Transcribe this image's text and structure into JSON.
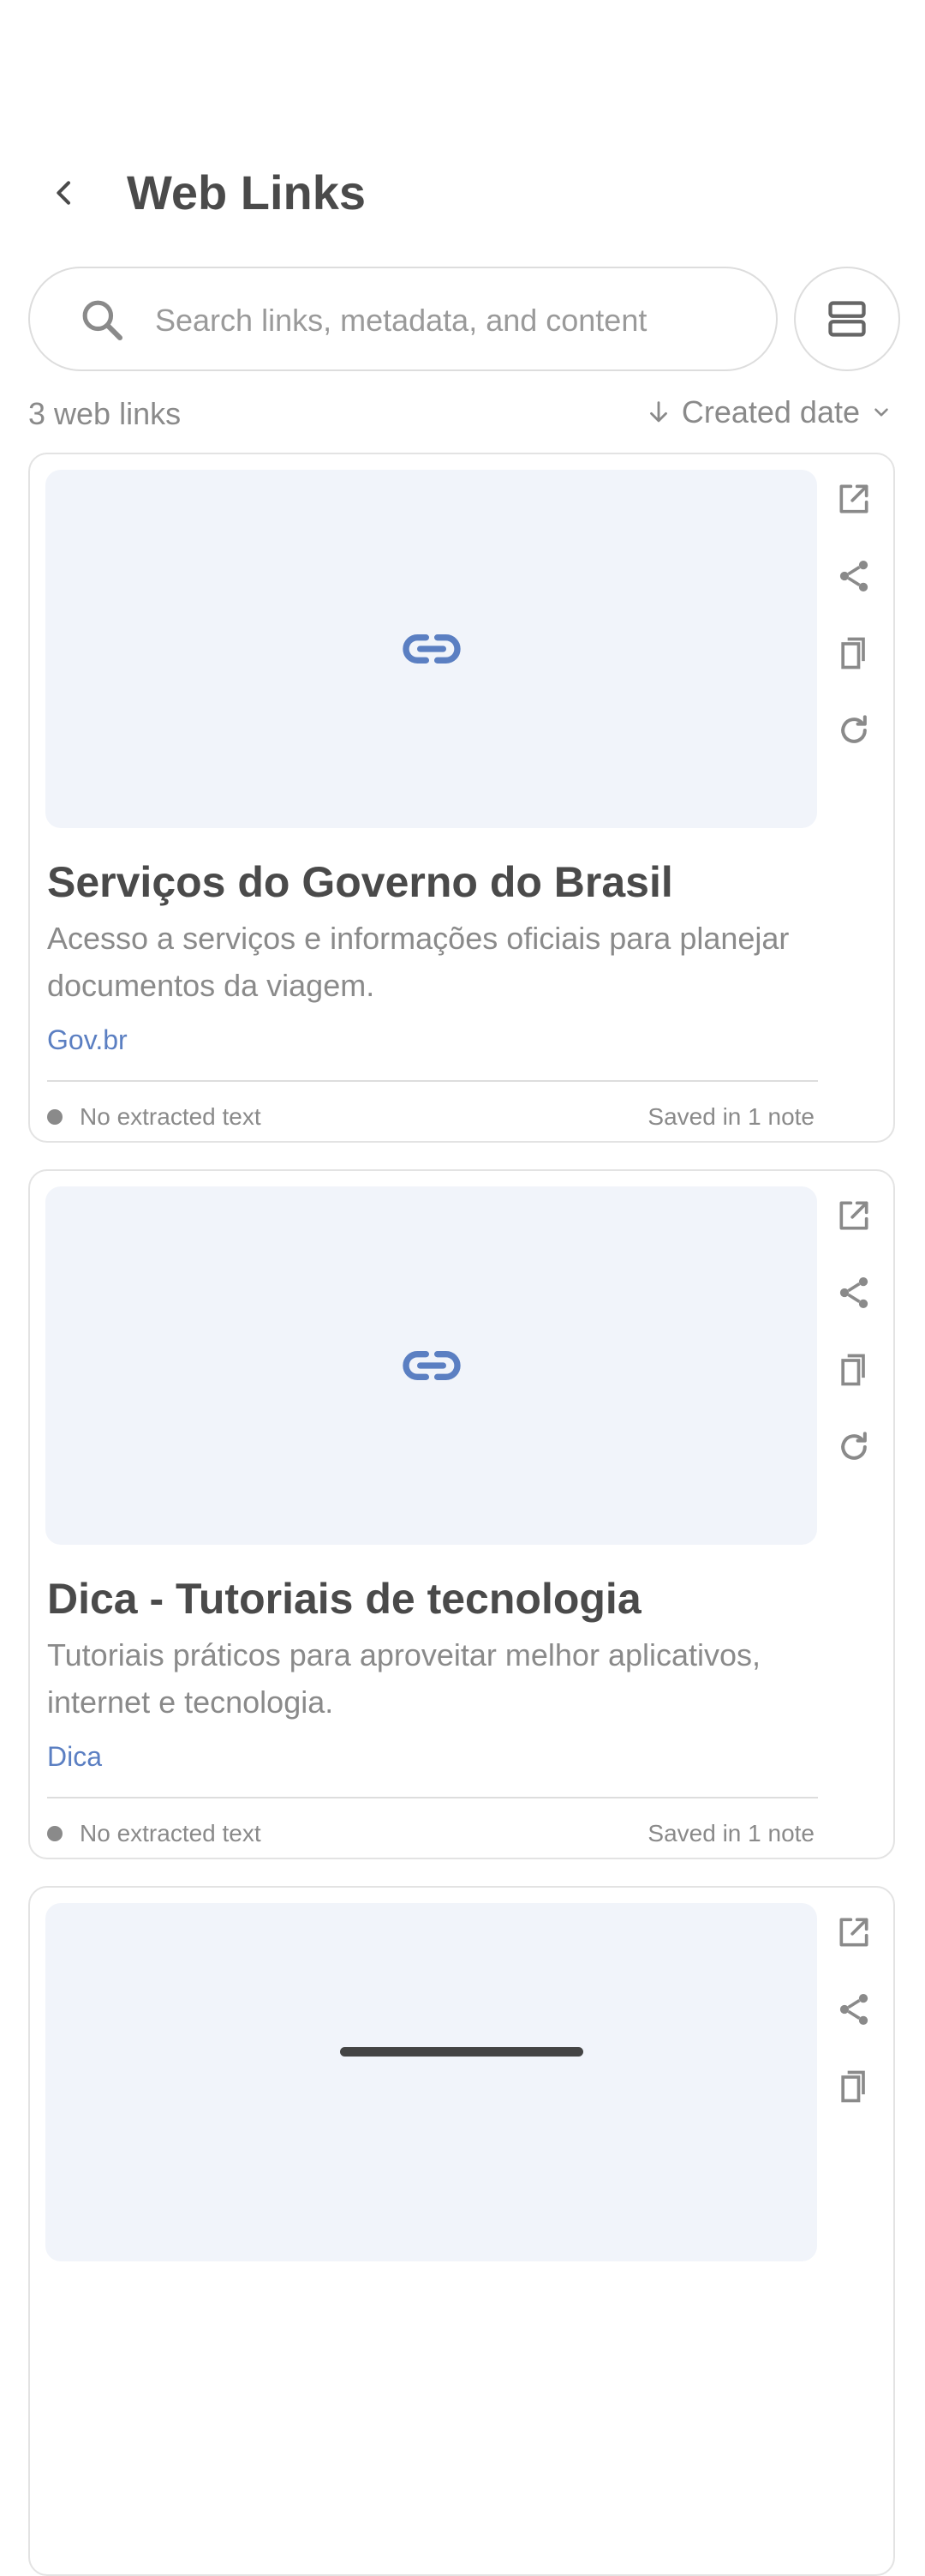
{
  "header": {
    "title": "Web Links"
  },
  "search": {
    "placeholder": "Search links, metadata, and content"
  },
  "list": {
    "count_label": "3 web links",
    "sort_label": "Created date"
  },
  "cards": [
    {
      "title": "Serviços do Governo do Brasil",
      "description": "Acesso a serviços e informações oficiais para planejar documentos da viagem.",
      "domain": "Gov.br",
      "status": "No extracted text",
      "saved": "Saved in 1 note"
    },
    {
      "title": "Dica - Tutoriais de tecnologia",
      "description": "Tutoriais práticos para aproveitar melhor aplicativos, internet e tecnologia.",
      "domain": "Dica",
      "status": "No extracted text",
      "saved": "Saved in 1 note"
    }
  ],
  "icons": {
    "back": "chevron-left-icon",
    "search": "search-icon",
    "layout": "view-agenda-icon",
    "link": "link-icon",
    "open": "open-external-icon",
    "share": "share-icon",
    "copy": "copy-icon",
    "refresh": "refresh-icon"
  },
  "colors": {
    "accent": "#5b7fc2",
    "thumb_bg": "#f1f4fa",
    "text": "#4a4a4a",
    "muted": "#8a8a8a"
  }
}
